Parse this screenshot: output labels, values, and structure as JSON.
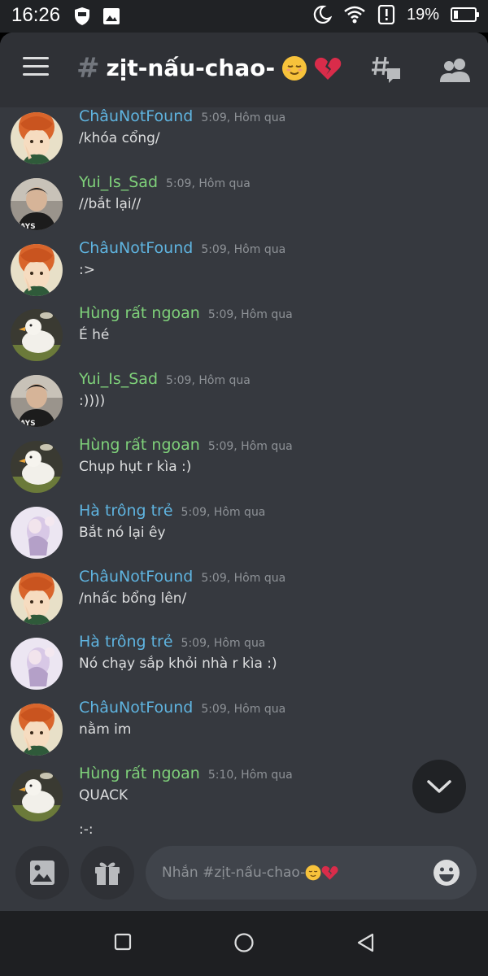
{
  "status_bar": {
    "time": "16:26",
    "battery": "19%",
    "battery_level": 0.19,
    "icons": [
      "shield-icon",
      "image-icon",
      "moon-icon",
      "wifi-icon",
      "alert-icon",
      "battery-icon"
    ]
  },
  "header": {
    "hash": "#",
    "channel_name": "zịt-nấu-chao-",
    "icons": [
      "menu-icon",
      "threads-icon",
      "members-icon"
    ]
  },
  "messages": [
    {
      "user": "ChâuNotFound",
      "time": "5:09, Hôm qua",
      "text": "/khóa cổng/",
      "color": "#5fb4e0",
      "avatar": "orange"
    },
    {
      "user": "Yui_Is_Sad",
      "time": "5:09, Hôm qua",
      "text": "//bắt lại//",
      "color": "#7fd17a",
      "avatar": "photo"
    },
    {
      "user": "ChâuNotFound",
      "time": "5:09, Hôm qua",
      "text": ":>",
      "color": "#5fb4e0",
      "avatar": "orange"
    },
    {
      "user": "Hùng rất ngoan",
      "time": "5:09, Hôm qua",
      "text": "É hé",
      "color": "#7fd17a",
      "avatar": "duck"
    },
    {
      "user": "Yui_Is_Sad",
      "time": "5:09, Hôm qua",
      "text": ":))))",
      "color": "#7fd17a",
      "avatar": "photo"
    },
    {
      "user": "Hùng rất ngoan",
      "time": "5:09, Hôm qua",
      "text": "Chụp hụt r kìa :)",
      "color": "#7fd17a",
      "avatar": "duck"
    },
    {
      "user": "Hà trông trẻ",
      "time": "5:09, Hôm qua",
      "text": "Bắt nó lại êy",
      "color": "#5fb4e0",
      "avatar": "pastel"
    },
    {
      "user": "ChâuNotFound",
      "time": "5:09, Hôm qua",
      "text": "/nhấc bổng lên/",
      "color": "#5fb4e0",
      "avatar": "orange"
    },
    {
      "user": "Hà trông trẻ",
      "time": "5:09, Hôm qua",
      "text": "Nó chạy sắp khỏi nhà r kìa :)",
      "color": "#5fb4e0",
      "avatar": "pastel"
    },
    {
      "user": "ChâuNotFound",
      "time": "5:09, Hôm qua",
      "text": "nằm im",
      "color": "#5fb4e0",
      "avatar": "orange"
    },
    {
      "user": "Hùng rất ngoan",
      "time": "5:10, Hôm qua",
      "text": "QUACK",
      "text2": ":-:",
      "color": "#7fd17a",
      "avatar": "duck"
    }
  ],
  "composer": {
    "placeholder": "Nhắn #zịt-nấu-chao-",
    "icons": [
      "image-upload-icon",
      "gift-icon",
      "emoji-icon"
    ]
  },
  "nav": {
    "icons": [
      "recents-square-icon",
      "home-circle-icon",
      "back-triangle-icon"
    ]
  },
  "colors": {
    "background": "#36393f",
    "header": "#2f3136",
    "username_blue": "#5fb4e0",
    "username_green": "#7fd17a",
    "text": "#dcddde",
    "muted": "#8e9297"
  }
}
